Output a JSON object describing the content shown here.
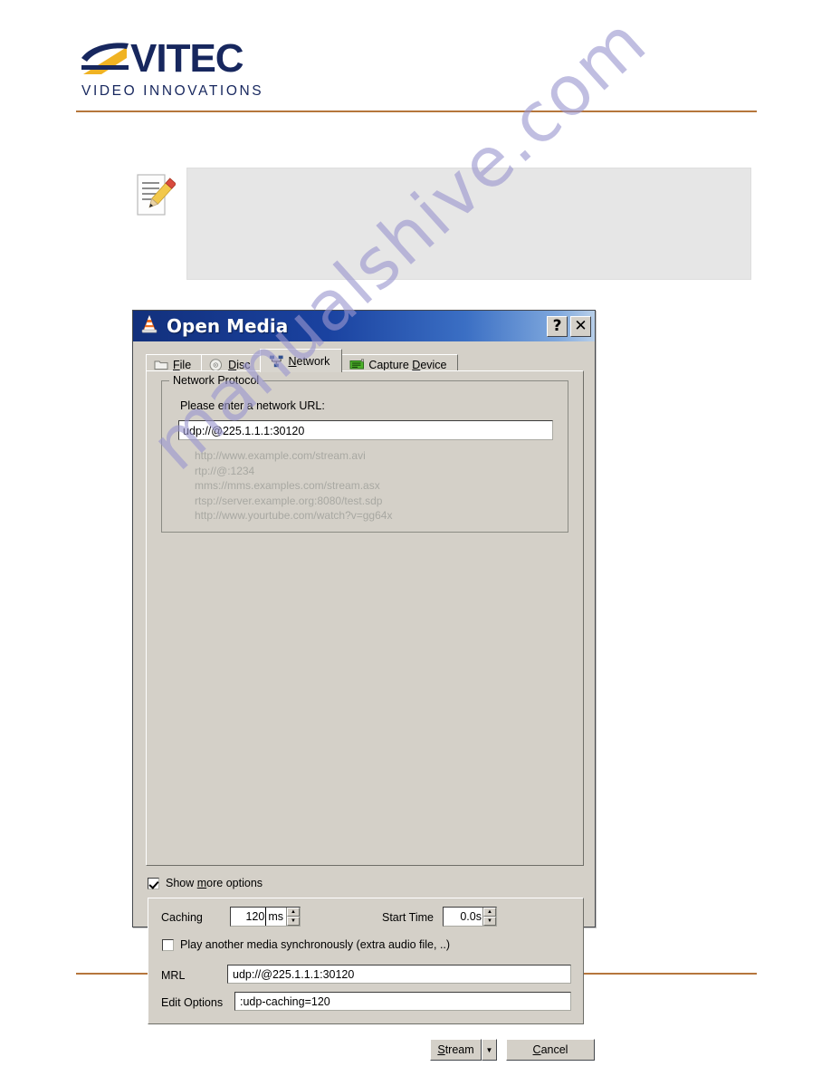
{
  "page": {
    "brand": {
      "name": "VITEC",
      "tagline": "VIDEO INNOVATIONS",
      "navy": "#17275e",
      "gold": "#f0b323",
      "rule_color": "#b5763c"
    },
    "watermark": "manualshive.com",
    "note": {
      "icon": "note-pencil-icon",
      "text": ""
    }
  },
  "dialog": {
    "title": "Open Media",
    "app_icon": "vlc-cone-icon",
    "titlebar_buttons": [
      {
        "name": "help-button",
        "label": "?"
      },
      {
        "name": "close-button",
        "label": "✕"
      }
    ],
    "tabs": [
      {
        "key": "file",
        "label_pre": "",
        "label_accel": "F",
        "label_post": "ile",
        "icon": "folder-icon",
        "active": false
      },
      {
        "key": "disc",
        "label_pre": "",
        "label_accel": "D",
        "label_post": "isc",
        "icon": "disc-icon",
        "active": false
      },
      {
        "key": "network",
        "label_pre": "",
        "label_accel": "N",
        "label_post": "etwork",
        "icon": "network-nodes-icon",
        "active": true
      },
      {
        "key": "capture",
        "label_pre": "Capture ",
        "label_accel": "D",
        "label_post": "evice",
        "icon": "capture-card-icon",
        "active": false
      }
    ],
    "network_tab": {
      "group_title": "Network Protocol",
      "url_prompt": "Please enter a network URL:",
      "url_value": "udp://@225.1.1.1:30120",
      "examples": [
        "http://www.example.com/stream.avi",
        "rtp://@:1234",
        "mms://mms.examples.com/stream.asx",
        "rtsp://server.example.org:8080/test.sdp",
        "http://www.yourtube.com/watch?v=gg64x"
      ]
    },
    "show_more": {
      "label_pre": "Show ",
      "label_accel": "m",
      "label_post": "ore options",
      "checked": true
    },
    "options": {
      "caching_label": "Caching",
      "caching_value": "120",
      "caching_unit": "ms",
      "start_time_label": "Start Time",
      "start_time_value": "0.0s",
      "sync_play_label": "Play another media synchronously (extra audio file, ..)",
      "sync_play_checked": false,
      "mrl_label": "MRL",
      "mrl_value": "udp://@225.1.1.1:30120",
      "edit_options_label": "Edit Options",
      "edit_options_value": ":udp-caching=120"
    },
    "buttons": {
      "stream_pre": "",
      "stream_accel": "S",
      "stream_post": "tream",
      "stream_caret": "▼",
      "cancel_pre": "",
      "cancel_accel": "C",
      "cancel_post": "ancel"
    }
  }
}
